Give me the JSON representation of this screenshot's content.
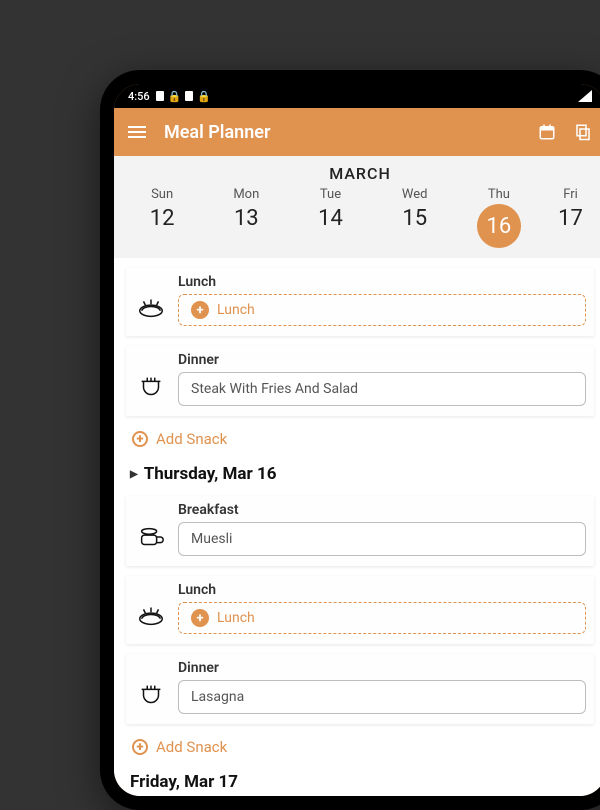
{
  "status": {
    "time": "4:56"
  },
  "header": {
    "title": "Meal Planner"
  },
  "calendar": {
    "month": "MARCH",
    "days": [
      {
        "name": "Sun",
        "num": "12",
        "selected": false
      },
      {
        "name": "Mon",
        "num": "13",
        "selected": false
      },
      {
        "name": "Tue",
        "num": "14",
        "selected": false
      },
      {
        "name": "Wed",
        "num": "15",
        "selected": false
      },
      {
        "name": "Thu",
        "num": "16",
        "selected": true
      },
      {
        "name": "Fri",
        "num": "17",
        "selected": false
      }
    ]
  },
  "accent_color": "#e0924f",
  "meals": {
    "lunch_label": "Lunch",
    "dinner_label": "Dinner",
    "breakfast_label": "Breakfast",
    "add_snack_label": "Add Snack",
    "placeholder_lunch": "Lunch"
  },
  "wednesday": {
    "dinner_value": "Steak With Fries And Salad"
  },
  "thursday": {
    "title": "Thursday, Mar 16",
    "breakfast_value": "Muesli",
    "dinner_value": "Lasagna"
  },
  "friday": {
    "title": "Friday, Mar 17"
  }
}
